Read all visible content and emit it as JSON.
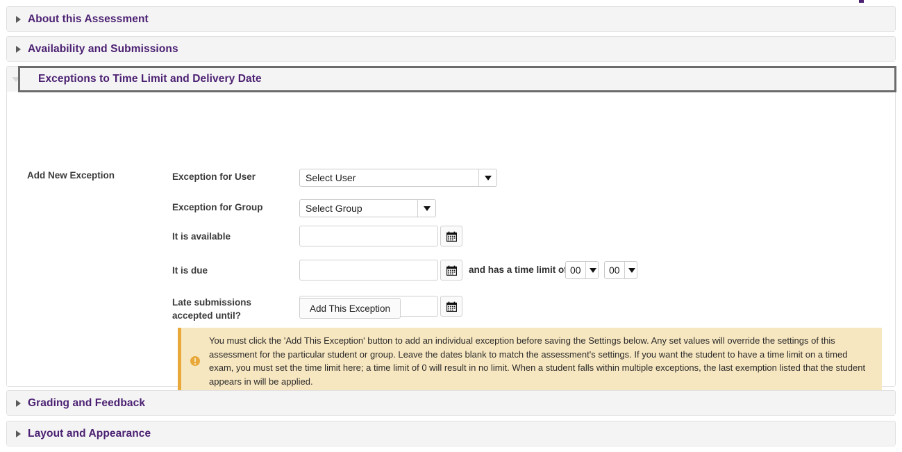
{
  "accordion": {
    "sections": [
      {
        "title": "About this Assessment",
        "state": "collapsed",
        "arrow_icon": "triangle-right-icon"
      },
      {
        "title": "Availability and Submissions",
        "state": "collapsed",
        "arrow_icon": "triangle-right-icon"
      },
      {
        "title": "Exceptions to Time Limit and Delivery Date",
        "state": "expanded",
        "arrow_icon": "triangle-down-icon"
      },
      {
        "title": "Grading and Feedback",
        "state": "collapsed",
        "arrow_icon": "triangle-right-icon"
      },
      {
        "title": "Layout and Appearance",
        "state": "collapsed",
        "arrow_icon": "triangle-down-icon"
      }
    ]
  },
  "exceptions_panel": {
    "section_label": "Add New Exception",
    "fields": {
      "user": {
        "label": "Exception for User",
        "selected": "Select User",
        "arrow_icon": "dropdown-arrow-icon"
      },
      "group": {
        "label": "Exception for Group",
        "selected": "Select Group",
        "arrow_icon": "dropdown-arrow-icon"
      },
      "available": {
        "label": "It is available",
        "value": "",
        "placeholder": "",
        "calendar_icon": "calendar-icon"
      },
      "due": {
        "label": "It is due",
        "value": "",
        "placeholder": "",
        "calendar_icon": "calendar-icon",
        "time_limit_text": "and has a time limit of",
        "time_limit_hours": "00",
        "time_limit_minutes": "00"
      },
      "late": {
        "label": "Late submissions accepted until?",
        "label_line1": "Late submissions",
        "label_line2": "accepted until?",
        "value": "",
        "placeholder": "",
        "calendar_icon": "calendar-icon"
      }
    },
    "add_button_label": "Add This Exception",
    "callout": {
      "icon": "warning-circle-icon",
      "text": "You must click the 'Add This Exception' button to add an individual exception before saving the Settings below. Any set values will override the settings of this assessment for the particular student or group. Leave the dates blank to match the assessment's settings. If you want the student to have a time limit on a timed exam, you must set the time limit here; a time limit of 0 will result in no limit. When a student falls within multiple exceptions, the last exemption listed that the student appears in will be applied."
    }
  },
  "colors": {
    "heading_purple": "#4b2072",
    "header_bg": "#f4f4f4",
    "callout_bg": "#f7e7c0",
    "callout_accent": "#e8a93a",
    "focus_outline": "#6b6b6b",
    "border": "#e0e0e0"
  }
}
